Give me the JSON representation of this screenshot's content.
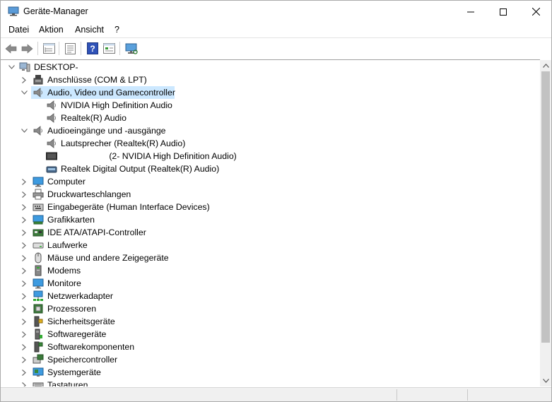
{
  "window": {
    "title": "Geräte-Manager",
    "minimize_icon": "minimize-icon",
    "maximize_icon": "maximize-icon",
    "close_icon": "close-icon"
  },
  "menu": [
    "Datei",
    "Aktion",
    "Ansicht",
    "?"
  ],
  "toolbar": [
    "back-arrow-icon",
    "forward-arrow-icon",
    "device-tree-icon",
    "properties-icon",
    "help-icon",
    "resources-view-icon",
    "monitor-scan-icon"
  ],
  "tree": {
    "root": "DESKTOP-",
    "rows": [
      {
        "label": "Anschlüsse (COM & LPT)",
        "icon": "port-icon",
        "state": "collapsed",
        "level": 1
      },
      {
        "label": "Audio, Video und Gamecontroller",
        "icon": "speaker-icon",
        "state": "expanded",
        "level": 1,
        "selected": true
      },
      {
        "label": "NVIDIA High Definition Audio",
        "icon": "speaker-icon",
        "state": "leaf",
        "level": 2
      },
      {
        "label": "Realtek(R) Audio",
        "icon": "speaker-icon",
        "state": "leaf",
        "level": 2
      },
      {
        "label": "Audioeingänge und -ausgänge",
        "icon": "speaker-icon",
        "state": "expanded",
        "level": 1
      },
      {
        "label": "Lautsprecher (Realtek(R) Audio)",
        "icon": "speaker-icon",
        "state": "leaf",
        "level": 2
      },
      {
        "label": "                    (2- NVIDIA High Definition Audio)",
        "icon": "display-device-icon",
        "state": "leaf",
        "level": 2
      },
      {
        "label": "Realtek Digital Output (Realtek(R) Audio)",
        "icon": "digital-output-icon",
        "state": "leaf",
        "level": 2
      },
      {
        "label": "Computer",
        "icon": "computer-icon",
        "state": "collapsed",
        "level": 1
      },
      {
        "label": "Druckwarteschlangen",
        "icon": "printer-icon",
        "state": "collapsed",
        "level": 1
      },
      {
        "label": "Eingabegeräte (Human Interface Devices)",
        "icon": "hid-icon",
        "state": "collapsed",
        "level": 1
      },
      {
        "label": "Grafikkarten",
        "icon": "graphics-card-icon",
        "state": "collapsed",
        "level": 1
      },
      {
        "label": "IDE ATA/ATAPI-Controller",
        "icon": "ide-controller-icon",
        "state": "collapsed",
        "level": 1
      },
      {
        "label": "Laufwerke",
        "icon": "drive-icon",
        "state": "collapsed",
        "level": 1
      },
      {
        "label": "Mäuse und andere Zeigegeräte",
        "icon": "mouse-icon",
        "state": "collapsed",
        "level": 1
      },
      {
        "label": "Modems",
        "icon": "modem-icon",
        "state": "collapsed",
        "level": 1
      },
      {
        "label": "Monitore",
        "icon": "monitor-icon",
        "state": "collapsed",
        "level": 1
      },
      {
        "label": "Netzwerkadapter",
        "icon": "network-adapter-icon",
        "state": "collapsed",
        "level": 1
      },
      {
        "label": "Prozessoren",
        "icon": "processor-icon",
        "state": "collapsed",
        "level": 1
      },
      {
        "label": "Sicherheitsgeräte",
        "icon": "security-device-icon",
        "state": "collapsed",
        "level": 1
      },
      {
        "label": "Softwaregeräte",
        "icon": "software-device-icon",
        "state": "collapsed",
        "level": 1
      },
      {
        "label": "Softwarekomponenten",
        "icon": "software-component-icon",
        "state": "collapsed",
        "level": 1
      },
      {
        "label": "Speichercontroller",
        "icon": "storage-controller-icon",
        "state": "collapsed",
        "level": 1
      },
      {
        "label": "Systemgeräte",
        "icon": "system-device-icon",
        "state": "collapsed",
        "level": 1
      },
      {
        "label": "Tastaturen",
        "icon": "keyboard-icon",
        "state": "collapsed",
        "level": 1
      }
    ]
  },
  "colors": {
    "selection": "#cce8ff",
    "chevron": "#6b6b6b"
  }
}
